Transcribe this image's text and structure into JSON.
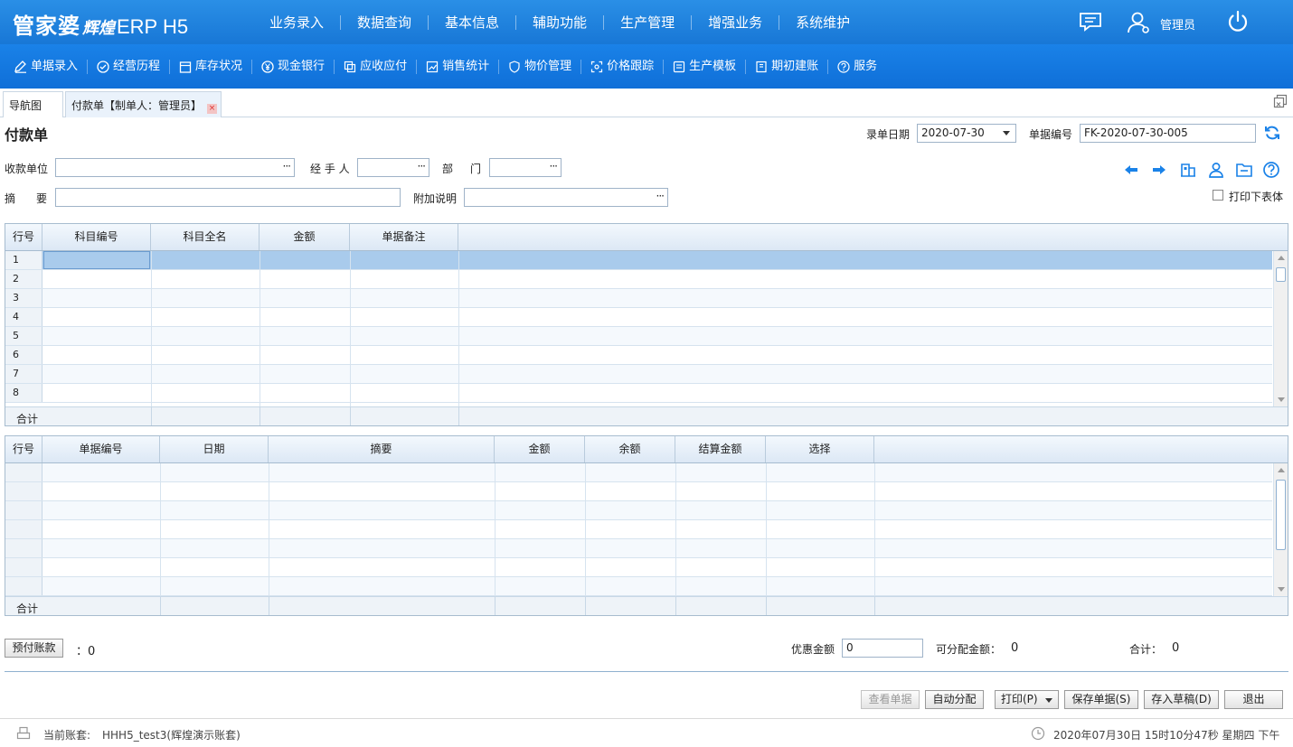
{
  "header": {
    "logo_main": "管家婆",
    "logo_sub": "辉煌",
    "logo_erp": "ERP H5",
    "nav": [
      "业务录入",
      "数据查询",
      "基本信息",
      "辅助功能",
      "生产管理",
      "增强业务",
      "系统维护"
    ],
    "user_name": "管理员"
  },
  "toolbar": {
    "items": [
      {
        "label": "单据录入",
        "icon": "edit-icon"
      },
      {
        "label": "经营历程",
        "icon": "check-circle-icon"
      },
      {
        "label": "库存状况",
        "icon": "warehouse-icon"
      },
      {
        "label": "现金银行",
        "icon": "yuan-icon"
      },
      {
        "label": "应收应付",
        "icon": "exchange-icon"
      },
      {
        "label": "销售统计",
        "icon": "chart-icon"
      },
      {
        "label": "物价管理",
        "icon": "shield-icon"
      },
      {
        "label": "价格跟踪",
        "icon": "target-icon"
      },
      {
        "label": "生产模板",
        "icon": "template-icon"
      },
      {
        "label": "期初建账",
        "icon": "book-icon"
      },
      {
        "label": "服务",
        "icon": "help-icon"
      }
    ]
  },
  "tabs": {
    "nav_label": "导航图",
    "active_label": "付款单【制单人：管理员】",
    "close_glyph": "×"
  },
  "form": {
    "title": "付款单",
    "date_label": "录单日期",
    "date_value": "2020-07-30",
    "number_label": "单据编号",
    "number_value": "FK-2020-07-30-005",
    "payee_label": "收款单位",
    "payee_value": "",
    "handler_label": "经 手 人",
    "handler_value": "",
    "dept_label_1": "部",
    "dept_label_2": "门",
    "dept_value": "",
    "summary_label_1": "摘",
    "summary_label_2": "要",
    "summary_value": "",
    "extra_label": "附加说明",
    "extra_value": "",
    "print_lower_label": "打印下表体",
    "dots": "···"
  },
  "grid1": {
    "headers": [
      "行号",
      "科目编号",
      "科目全名",
      "金额",
      "单据备注"
    ],
    "rows": [
      "1",
      "2",
      "3",
      "4",
      "5",
      "6",
      "7",
      "8"
    ],
    "footer": "合计"
  },
  "grid2": {
    "headers": [
      "行号",
      "单据编号",
      "日期",
      "摘要",
      "金额",
      "余额",
      "结算金额",
      "选择"
    ],
    "footer": "合计"
  },
  "bottom": {
    "prepay_button": "预付账款",
    "prepay_value": "：0",
    "discount_label": "优惠金额",
    "discount_value": "0",
    "allocatable_label": "可分配金额：",
    "allocatable_value": "0",
    "total_label": "合计：",
    "total_value": "0",
    "buttons": {
      "view": "查看单据",
      "auto_alloc": "自动分配",
      "print": "打印(P)",
      "save": "保存单据(S)",
      "draft": "存入草稿(D)",
      "exit": "退出"
    }
  },
  "status": {
    "account_label": "当前账套:",
    "account_value": "HHH5_test3(辉煌演示账套)",
    "datetime": "2020年07月30日 15时10分47秒 星期四 下午"
  },
  "colors": {
    "header_blue": "#1877d6",
    "selected_row": "#a9cbec"
  }
}
